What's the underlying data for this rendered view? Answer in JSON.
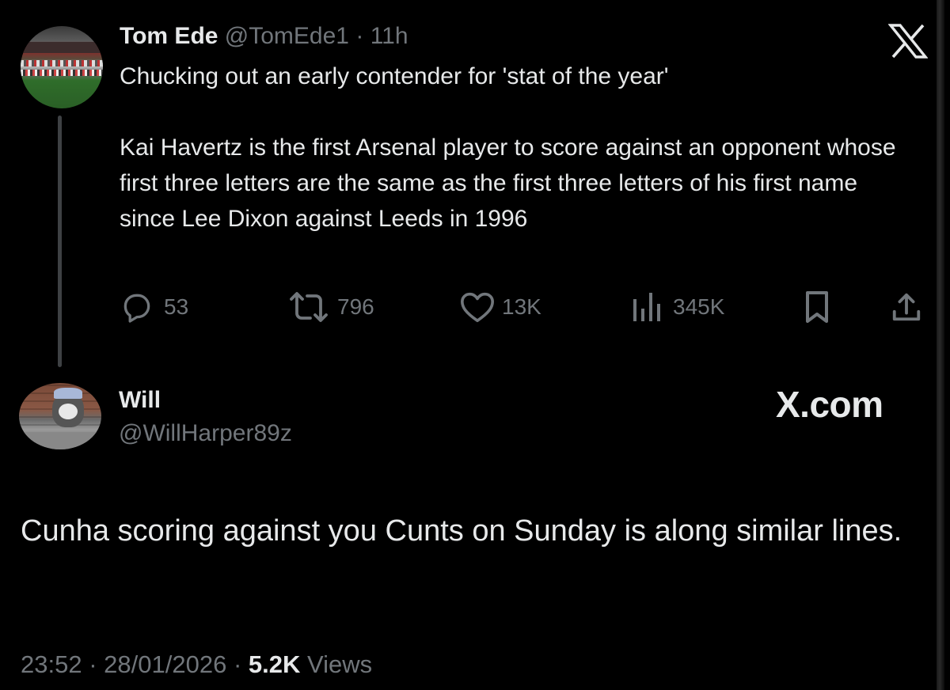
{
  "tweet": {
    "author_name": "Tom Ede",
    "author_handle": "@TomEde1",
    "separator": "·",
    "time": "11h",
    "lines": [
      "Chucking out an early contender for 'stat of the year'",
      "Kai Havertz is the first Arsenal player to score against an opponent whose first three letters are the same as the first three letters of his first name since Lee Dixon against Leeds in 1996"
    ],
    "actions": {
      "replies": "53",
      "reposts": "796",
      "likes": "13K",
      "views": "345K"
    },
    "icons": [
      "reply-icon",
      "repost-icon",
      "like-icon",
      "views-icon",
      "bookmark-icon",
      "share-icon"
    ]
  },
  "branding": {
    "logo": "X",
    "site": "X.com"
  },
  "reply": {
    "author_name": "Will",
    "author_handle": "@WillHarper89z",
    "text": "Cunha scoring against you Cunts on Sunday is along similar lines.",
    "time": "23:52",
    "date": "28/01/2026",
    "separator": "·",
    "views_count": "5.2K",
    "views_label": "Views"
  },
  "colors": {
    "background": "#000000",
    "text_primary": "#e7e9ea",
    "text_secondary": "#71767b",
    "thread_line": "#3e4144"
  }
}
